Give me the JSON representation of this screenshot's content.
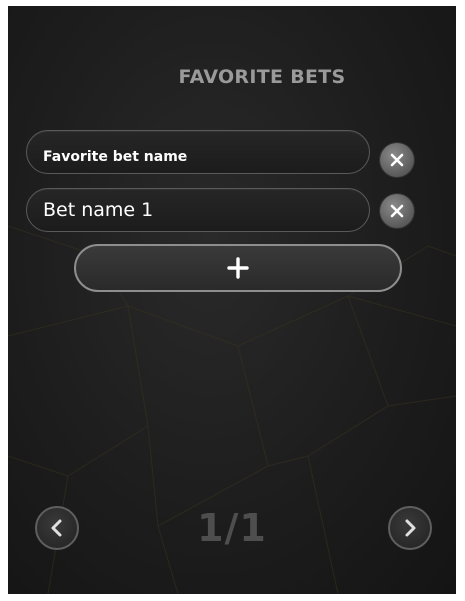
{
  "panel": {
    "title": "FAVORITE BETS"
  },
  "bets": [
    {
      "value": "Favorite bet name",
      "delete_icon": "close-icon"
    },
    {
      "value": "Bet name 1",
      "delete_icon": "close-icon"
    }
  ],
  "add_button": {
    "label": "+",
    "icon": "plus-icon"
  },
  "pagination": {
    "text": "1/1",
    "prev_icon": "chevron-left-icon",
    "next_icon": "chevron-right-icon"
  },
  "colors": {
    "background": "#1d1d1d",
    "title": "#9a9a9a",
    "text": "#ffffff",
    "pager_text": "#4e4e4e",
    "button_border": "#8e8e8e"
  }
}
